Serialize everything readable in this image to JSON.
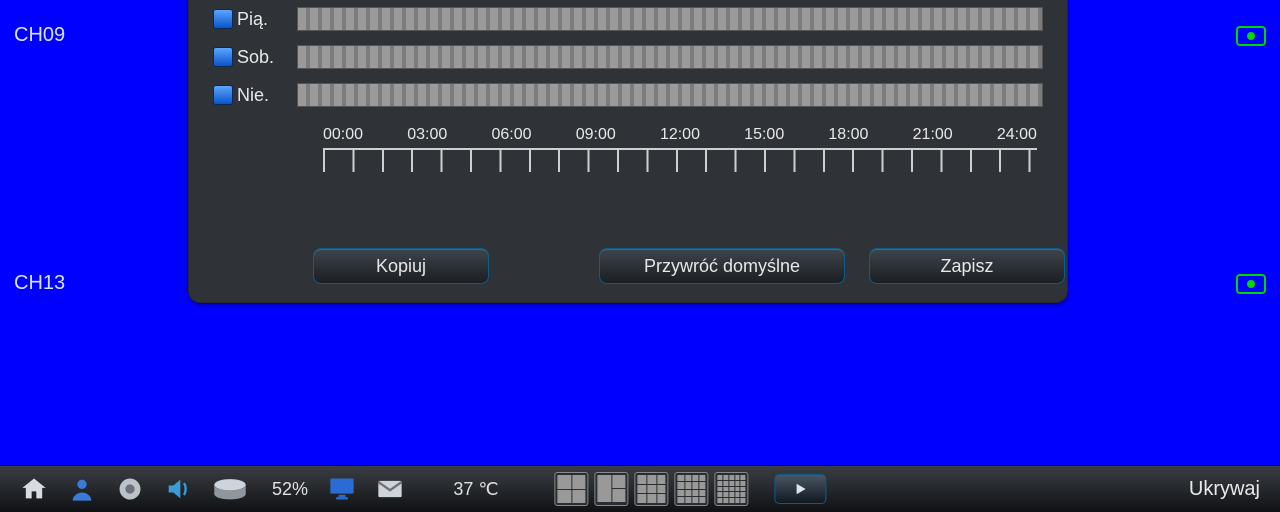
{
  "channels": {
    "top": "CH09",
    "bottom": "CH13"
  },
  "schedule": {
    "days": [
      {
        "label": "Pią."
      },
      {
        "label": "Sob."
      },
      {
        "label": "Nie."
      }
    ],
    "timeline": [
      "00:00",
      "03:00",
      "06:00",
      "09:00",
      "12:00",
      "15:00",
      "18:00",
      "21:00",
      "24:00"
    ]
  },
  "buttons": {
    "copy": "Kopiuj",
    "restore": "Przywróć  domyślne",
    "save": "Zapisz"
  },
  "taskbar": {
    "disk_percent": "52%",
    "temperature": "37  ℃",
    "hide": "Ukrywaj",
    "icons": {
      "home": "home-icon",
      "user": "user-icon",
      "alarm": "alarm-icon",
      "speaker": "speaker-icon",
      "disk": "disk-icon",
      "monitor": "monitor-icon",
      "mail": "mail-icon",
      "play": "play-icon"
    },
    "grid_modes": [
      "2x2",
      "1+3",
      "3x3",
      "4x4",
      "5x5"
    ]
  },
  "status_icon": "money-status-icon",
  "colors": {
    "bg": "#0000ff",
    "panel": "#2f3338",
    "accent": "#00c800"
  }
}
